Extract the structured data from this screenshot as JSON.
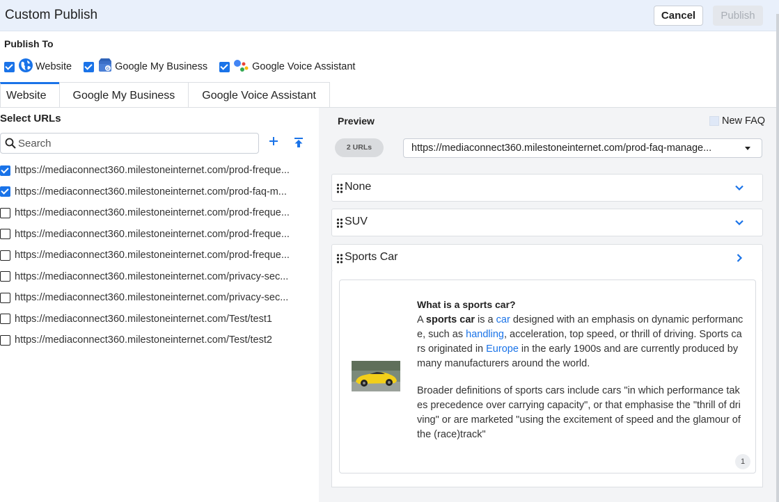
{
  "header": {
    "title": "Custom Publish",
    "cancel_label": "Cancel",
    "publish_label": "Publish"
  },
  "publish_to": {
    "label": "Publish To",
    "targets": [
      {
        "label": "Website",
        "checked": true,
        "icon": "globe-icon"
      },
      {
        "label": "Google My Business",
        "checked": true,
        "icon": "google-my-business-icon"
      },
      {
        "label": "Google Voice Assistant",
        "checked": true,
        "icon": "google-assistant-icon"
      }
    ]
  },
  "tabs": [
    {
      "label": "Website",
      "active": true
    },
    {
      "label": "Google My Business",
      "active": false
    },
    {
      "label": "Google Voice Assistant",
      "active": false
    }
  ],
  "left": {
    "title": "Select URLs",
    "search_placeholder": "Search",
    "urls": [
      {
        "text": "https://mediaconnect360.milestoneinternet.com/prod-freque...",
        "checked": true
      },
      {
        "text": "https://mediaconnect360.milestoneinternet.com/prod-faq-m...",
        "checked": true
      },
      {
        "text": "https://mediaconnect360.milestoneinternet.com/prod-freque...",
        "checked": false
      },
      {
        "text": "https://mediaconnect360.milestoneinternet.com/prod-freque...",
        "checked": false
      },
      {
        "text": "https://mediaconnect360.milestoneinternet.com/prod-freque...",
        "checked": false
      },
      {
        "text": "https://mediaconnect360.milestoneinternet.com/privacy-sec...",
        "checked": false
      },
      {
        "text": "https://mediaconnect360.milestoneinternet.com/privacy-sec...",
        "checked": false
      },
      {
        "text": "https://mediaconnect360.milestoneinternet.com/Test/test1",
        "checked": false
      },
      {
        "text": "https://mediaconnect360.milestoneinternet.com/Test/test2",
        "checked": false
      }
    ]
  },
  "preview": {
    "label": "Preview",
    "new_faq_label": "New FAQ",
    "url_count": "2 URLs",
    "selected_url": "https://mediaconnect360.milestoneinternet.com/prod-faq-manage...",
    "sections": [
      {
        "label": "None",
        "state": "collapsed"
      },
      {
        "label": "SUV",
        "state": "collapsed"
      },
      {
        "label": "Sports Car",
        "state": "expanded"
      }
    ],
    "faq": {
      "question": "What is a sports car?",
      "answer_parts": {
        "p1": "A ",
        "b1": "sports car",
        "p2": " is a ",
        "l1": "car",
        "p3": " designed with an emphasis on dynamic performance, such as ",
        "l2": "handling",
        "p4": ", acceleration, top speed, or thrill of driving. Sports cars originated in ",
        "l3": "Europe",
        "p5": " in the early 1900s and are currently produced by many manufacturers around the world."
      },
      "answer_second": "Broader definitions of sports cars include cars \"in which performance takes precedence over carrying capacity\", or that emphasise the \"thrill of driving\" or are marketed \"using the excitement of speed and the glamour of the (race)track\"",
      "page": "1"
    }
  },
  "colors": {
    "accent": "#1a73e8",
    "header_bg": "#e9f0fb",
    "preview_bg": "#f3f4f6"
  }
}
